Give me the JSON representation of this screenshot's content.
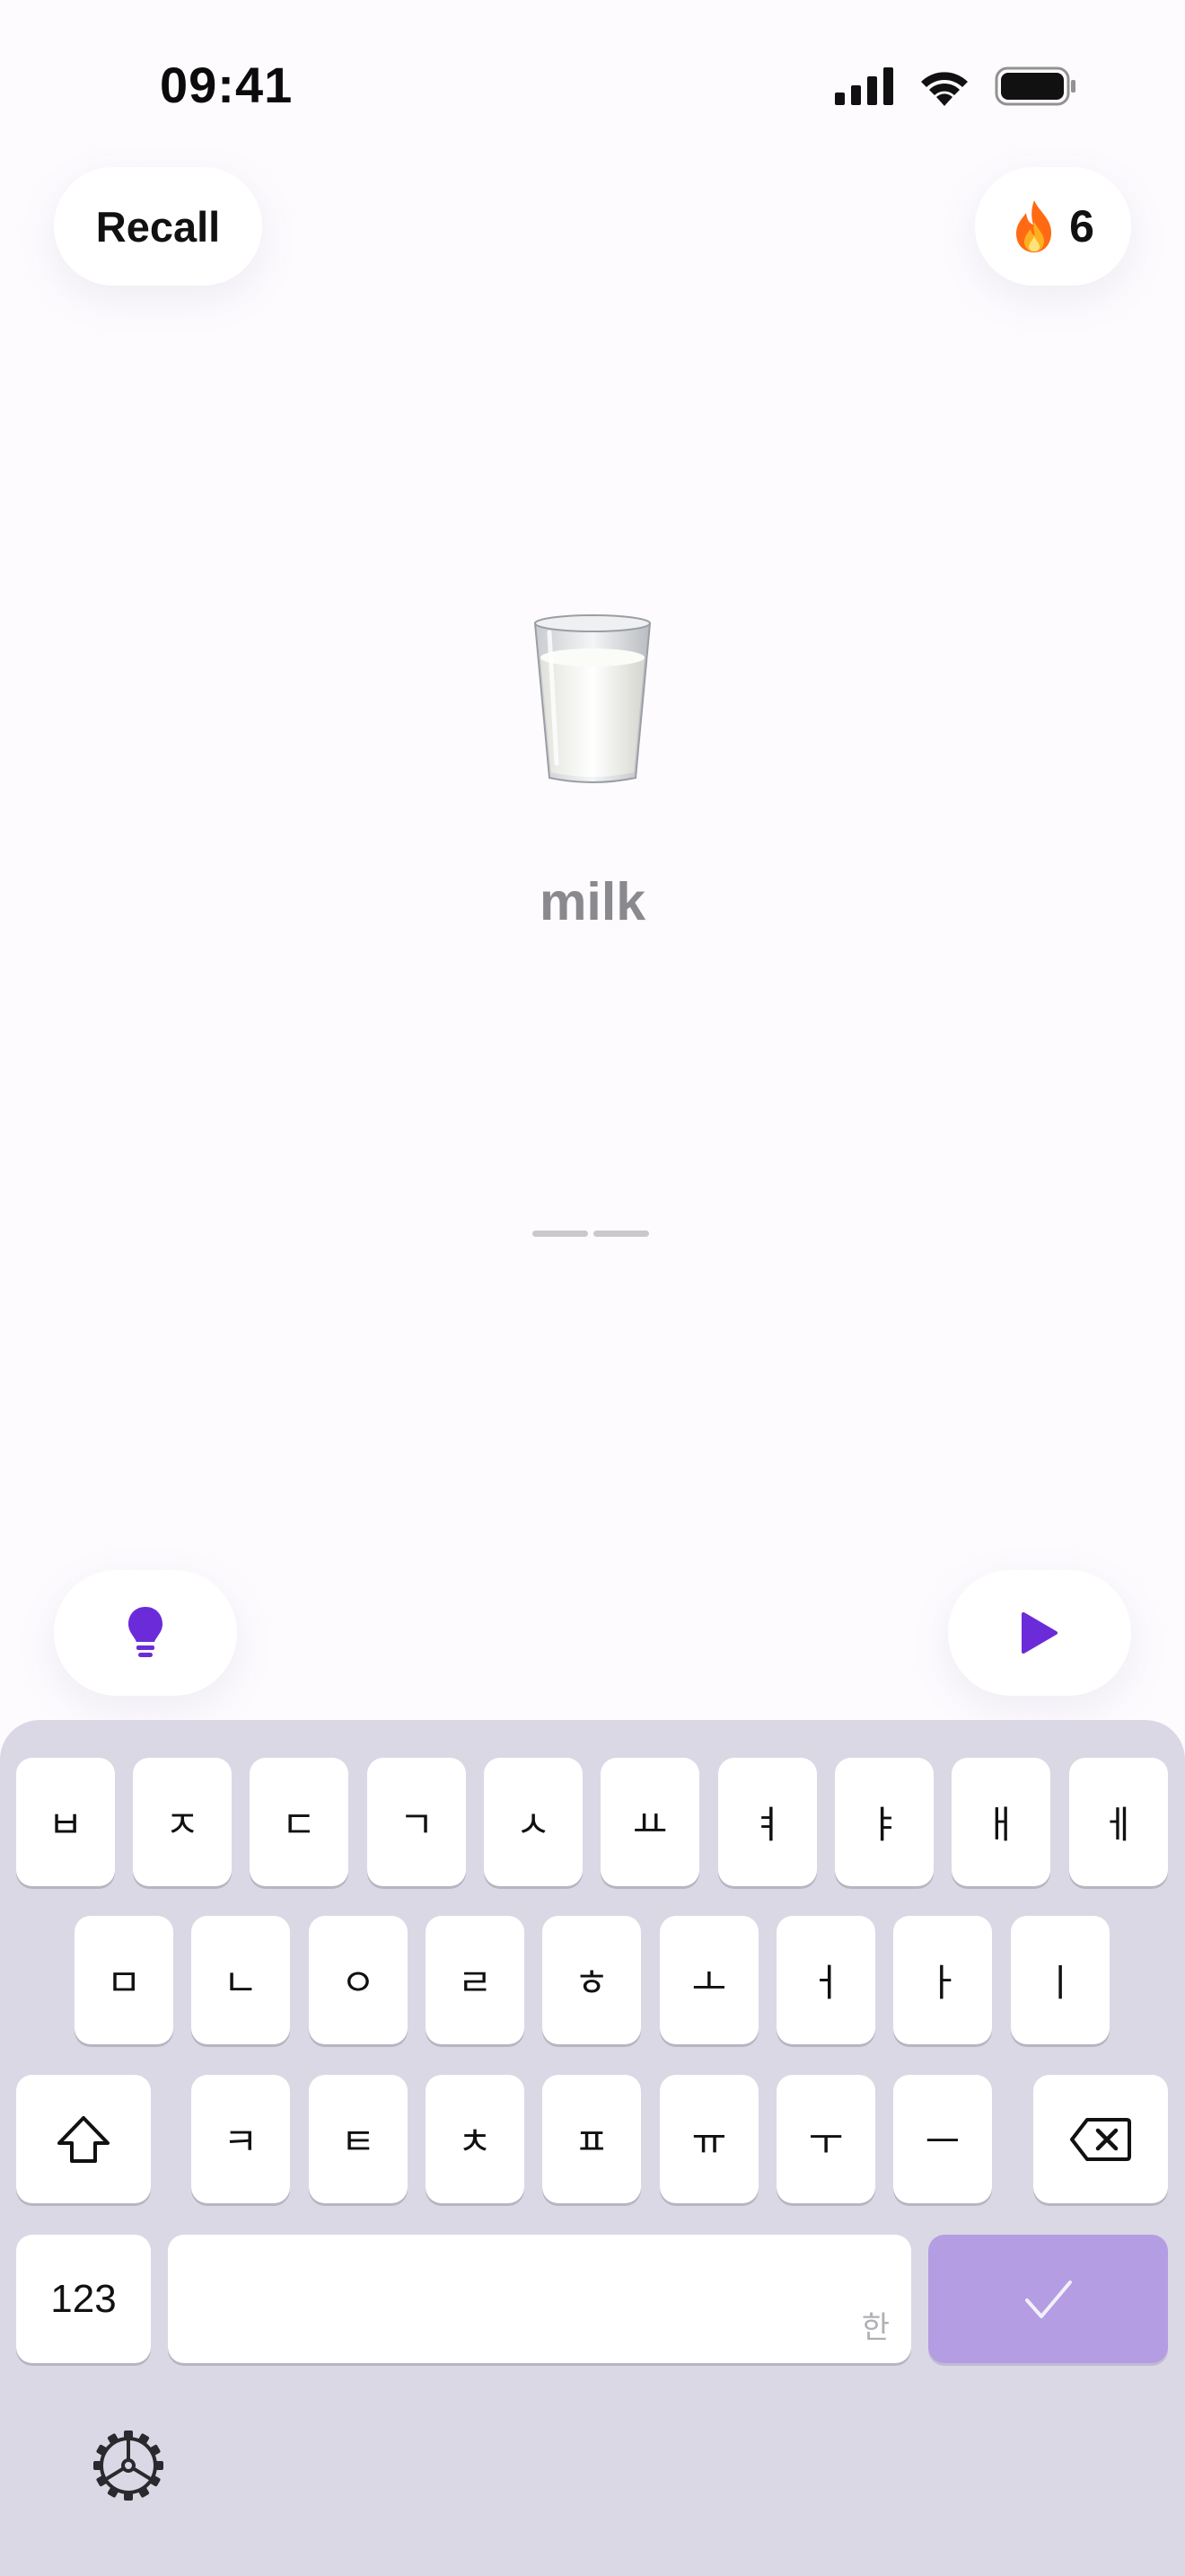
{
  "status_bar": {
    "time": "09:41"
  },
  "header": {
    "mode_label": "Recall",
    "streak_icon": "fire-icon",
    "streak_count": "6"
  },
  "prompt": {
    "image_icon": "glass-of-milk-icon",
    "word": "milk",
    "answer_length": 2
  },
  "actions": {
    "hint_icon": "lightbulb-icon",
    "play_icon": "play-icon"
  },
  "keyboard": {
    "row1": [
      "ㅂ",
      "ㅈ",
      "ㄷ",
      "ㄱ",
      "ㅅ",
      "ㅛ",
      "ㅕ",
      "ㅑ",
      "ㅐ",
      "ㅔ"
    ],
    "row2": [
      "ㅁ",
      "ㄴ",
      "ㅇ",
      "ㄹ",
      "ㅎ",
      "ㅗ",
      "ㅓ",
      "ㅏ",
      "ㅣ"
    ],
    "row3": [
      "ㅋ",
      "ㅌ",
      "ㅊ",
      "ㅍ",
      "ㅠ",
      "ㅜ",
      "ㅡ"
    ],
    "numbers_label": "123",
    "language_label": "한",
    "shift_icon": "shift-icon",
    "delete_icon": "backspace-icon",
    "submit_icon": "checkmark-icon",
    "settings_icon": "gear-icon",
    "accent_color": "#b49de2",
    "background_color": "#dbd8e5"
  },
  "colors": {
    "accent": "#6c2bd9",
    "muted_text": "#8a8a8e",
    "streak": "#ff7a1a"
  }
}
